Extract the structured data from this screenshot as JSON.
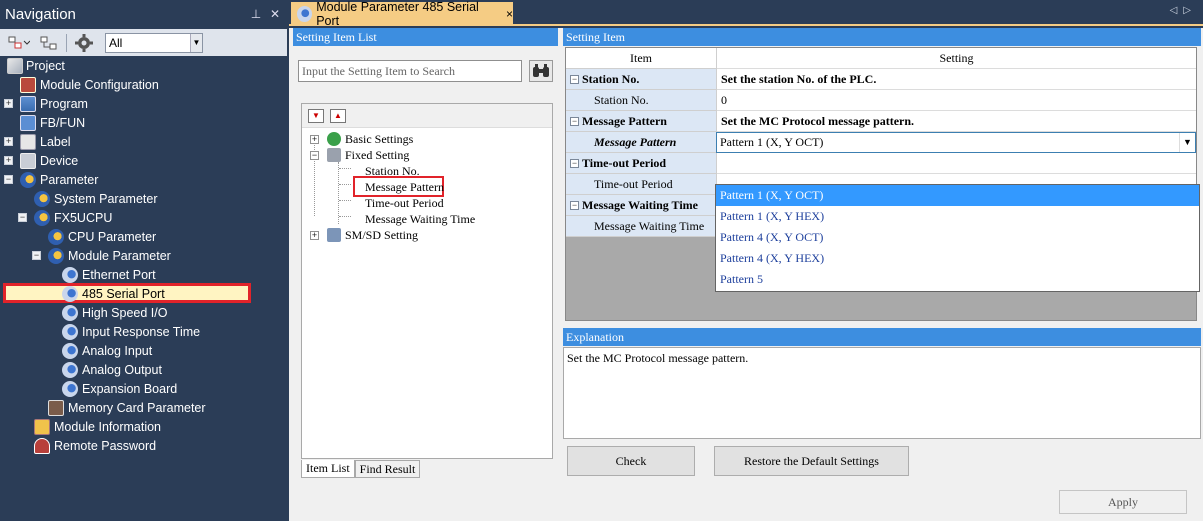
{
  "navigation": {
    "title": "Navigation",
    "pin_icon": "pin-icon",
    "close_glyph": "✕",
    "filter_value": "All",
    "tree": [
      {
        "label": "Project",
        "icon": "project-icon"
      },
      {
        "label": "Module Configuration",
        "icon": "module-config-icon"
      },
      {
        "label": "Program",
        "icon": "program-icon"
      },
      {
        "label": "FB/FUN",
        "icon": "fb-icon"
      },
      {
        "label": "Label",
        "icon": "label-icon"
      },
      {
        "label": "Device",
        "icon": "device-icon"
      },
      {
        "label": "Parameter",
        "icon": "parameter-icon"
      },
      {
        "label": "System Parameter",
        "icon": "parameter-icon"
      },
      {
        "label": "FX5UCPU",
        "icon": "parameter-icon"
      },
      {
        "label": "CPU Parameter",
        "icon": "parameter-icon"
      },
      {
        "label": "Module Parameter",
        "icon": "parameter-icon"
      },
      {
        "label": "Ethernet Port",
        "icon": "port-icon"
      },
      {
        "label": "485 Serial Port",
        "icon": "port-icon"
      },
      {
        "label": "High Speed I/O",
        "icon": "port-icon"
      },
      {
        "label": "Input Response Time",
        "icon": "port-icon"
      },
      {
        "label": "Analog Input",
        "icon": "port-icon"
      },
      {
        "label": "Analog Output",
        "icon": "port-icon"
      },
      {
        "label": "Expansion Board",
        "icon": "port-icon"
      },
      {
        "label": "Memory Card Parameter",
        "icon": "memory-card-icon"
      },
      {
        "label": "Module Information",
        "icon": "module-info-icon"
      },
      {
        "label": "Remote Password",
        "icon": "password-icon"
      }
    ]
  },
  "document": {
    "tab_title": "Module Parameter 485 Serial Port",
    "tab_close": "×",
    "setting_item_list": {
      "header": "Setting Item List",
      "search_placeholder": "Input the Setting Item to Search",
      "items": [
        {
          "label": "Basic Settings"
        },
        {
          "label": "Fixed Setting"
        },
        {
          "label": "Station No."
        },
        {
          "label": "Message Pattern"
        },
        {
          "label": "Time-out Period"
        },
        {
          "label": "Message Waiting Time"
        },
        {
          "label": "SM/SD Setting"
        }
      ],
      "bottom_tabs": [
        "Item List",
        "Find Result"
      ]
    },
    "setting_item": {
      "header": "Setting Item",
      "col_item": "Item",
      "col_setting": "Setting",
      "rows": [
        {
          "item": "Station No.",
          "setting": "Set the station No. of the PLC."
        },
        {
          "item": "Station No.",
          "setting": "0"
        },
        {
          "item": "Message Pattern",
          "setting": "Set the MC Protocol message pattern."
        },
        {
          "item": "Message Pattern",
          "setting": "Pattern 1 (X, Y OCT)"
        },
        {
          "item": "Time-out Period",
          "setting": ""
        },
        {
          "item": "Time-out Period",
          "setting": ""
        },
        {
          "item": "Message Waiting Time",
          "setting": ""
        },
        {
          "item": "Message Waiting Time",
          "setting": ""
        }
      ],
      "dropdown_options": [
        "Pattern 1 (X, Y OCT)",
        "Pattern 1 (X, Y HEX)",
        "Pattern 4 (X, Y OCT)",
        "Pattern 4 (X, Y HEX)",
        "Pattern 5"
      ]
    },
    "explanation": {
      "header": "Explanation",
      "text": "Set the MC Protocol message pattern."
    },
    "buttons": {
      "check": "Check",
      "restore": "Restore the Default Settings",
      "apply": "Apply"
    }
  }
}
